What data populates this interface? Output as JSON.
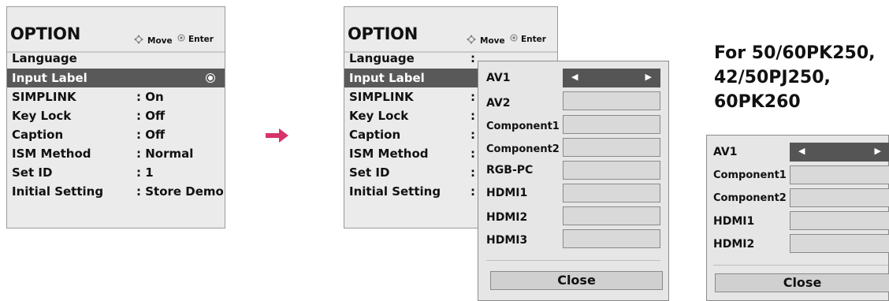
{
  "menu_left": {
    "title": "OPTION",
    "hint_move": "Move",
    "hint_enter": "Enter",
    "items": [
      {
        "label": "Language",
        "value": ""
      },
      {
        "label": "Input Label",
        "value": ""
      },
      {
        "label": "SIMPLINK",
        "value": ": On"
      },
      {
        "label": "Key Lock",
        "value": ": Off"
      },
      {
        "label": "Caption",
        "value": ": Off"
      },
      {
        "label": "ISM Method",
        "value": ": Normal"
      },
      {
        "label": "Set ID",
        "value": ": 1"
      },
      {
        "label": "Initial Setting",
        "value": ": Store Demo"
      }
    ]
  },
  "menu_right": {
    "title": "OPTION",
    "hint_move": "Move",
    "hint_enter": "Enter",
    "items": [
      {
        "label": "Language"
      },
      {
        "label": "Input Label"
      },
      {
        "label": "SIMPLINK"
      },
      {
        "label": "Key Lock"
      },
      {
        "label": "Caption"
      },
      {
        "label": "ISM Method"
      },
      {
        "label": "Set ID"
      },
      {
        "label": "Initial Setting"
      }
    ]
  },
  "popup_main": {
    "inputs": [
      "AV1",
      "AV2",
      "Component1",
      "Component2",
      "RGB-PC",
      "HDMI1",
      "HDMI2",
      "HDMI3"
    ],
    "close_label": "Close"
  },
  "popup_small": {
    "inputs": [
      "AV1",
      "Component1",
      "Component2",
      "HDMI1",
      "HDMI2"
    ],
    "close_label": "Close"
  },
  "note": {
    "line1": "For 50/60PK250,",
    "line2": "42/50PJ250,",
    "line3": "60PK260"
  },
  "icons": {
    "move": "four-way-arrow-icon",
    "enter": "enter-circle-icon",
    "selected": "radio-selected-icon",
    "left": "left-arrow-icon",
    "right": "right-arrow-icon",
    "flow": "right-arrow-icon"
  },
  "colors": {
    "highlight": "#595959",
    "menu_bg": "#ebebeb",
    "arrow": "#d6336c"
  }
}
